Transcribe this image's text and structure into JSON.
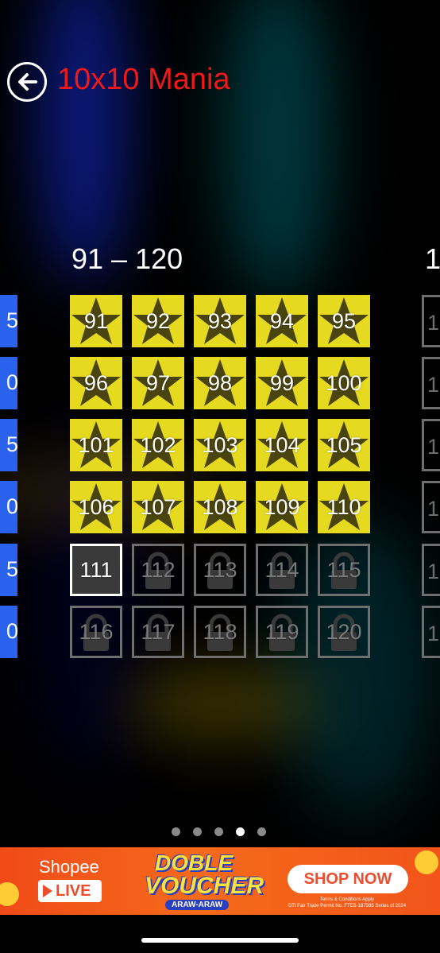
{
  "header": {
    "title": "10x10 Mania"
  },
  "page": {
    "title": "91 – 120",
    "rows": [
      [
        {
          "n": "91",
          "state": "solved"
        },
        {
          "n": "92",
          "state": "solved"
        },
        {
          "n": "93",
          "state": "solved"
        },
        {
          "n": "94",
          "state": "solved"
        },
        {
          "n": "95",
          "state": "solved"
        }
      ],
      [
        {
          "n": "96",
          "state": "solved"
        },
        {
          "n": "97",
          "state": "solved"
        },
        {
          "n": "98",
          "state": "solved"
        },
        {
          "n": "99",
          "state": "solved"
        },
        {
          "n": "100",
          "state": "solved"
        }
      ],
      [
        {
          "n": "101",
          "state": "solved"
        },
        {
          "n": "102",
          "state": "solved"
        },
        {
          "n": "103",
          "state": "solved"
        },
        {
          "n": "104",
          "state": "solved"
        },
        {
          "n": "105",
          "state": "solved"
        }
      ],
      [
        {
          "n": "106",
          "state": "solved"
        },
        {
          "n": "107",
          "state": "solved"
        },
        {
          "n": "108",
          "state": "solved"
        },
        {
          "n": "109",
          "state": "solved"
        },
        {
          "n": "110",
          "state": "solved"
        }
      ],
      [
        {
          "n": "111",
          "state": "current"
        },
        {
          "n": "112",
          "state": "locked"
        },
        {
          "n": "113",
          "state": "locked"
        },
        {
          "n": "114",
          "state": "locked"
        },
        {
          "n": "115",
          "state": "locked"
        }
      ],
      [
        {
          "n": "116",
          "state": "locked"
        },
        {
          "n": "117",
          "state": "locked"
        },
        {
          "n": "118",
          "state": "locked"
        },
        {
          "n": "119",
          "state": "locked"
        },
        {
          "n": "120",
          "state": "locked"
        }
      ]
    ]
  },
  "prev_page_sliver": [
    "5",
    "0",
    "5",
    "0",
    "5",
    "0"
  ],
  "next_page_sliver": {
    "title": "1",
    "tiles": [
      "1",
      "1",
      "1",
      "1",
      "1",
      "1"
    ]
  },
  "pager": {
    "count": 5,
    "active_index": 3
  },
  "ad": {
    "brand": "Shopee",
    "live_label": "LIVE",
    "headline_1": "DOBLE",
    "headline_2": "VOUCHER",
    "tagline": "ARAW-ARAW",
    "cta": "SHOP NOW",
    "terms_1": "Terms & Conditions Apply",
    "terms_2": "DTI Fair Trade Permit No. FTEB-187565 Series of 2024"
  },
  "colors": {
    "solved_tile": "#e6da20",
    "title_red": "#f01818",
    "prev_page_tile": "#2a62ee",
    "locked_border": "#6e6e6e",
    "ad_orange": "#f04a18"
  },
  "icons": {
    "back": "back-arrow-icon",
    "solved": "star-icon",
    "locked": "padlock-icon"
  }
}
